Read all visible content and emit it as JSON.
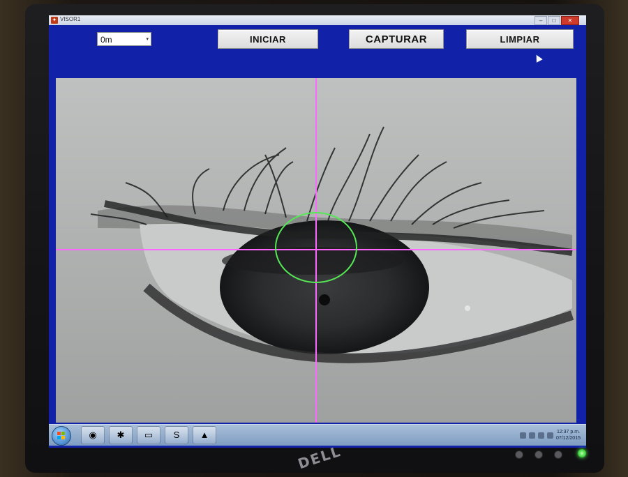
{
  "window": {
    "title": "VISOR1"
  },
  "toolbar": {
    "distance_select": {
      "value": "0m"
    },
    "iniciar_label": "INICIAR",
    "capturar_label": "CAPTURAR",
    "limpiar_label": "LIMPIAR"
  },
  "overlay": {
    "crosshair_color": "#ff66ff",
    "circle_color": "#55e855"
  },
  "taskbar": {
    "items": [
      "start-orb",
      "chrome",
      "app",
      "explorer",
      "skype",
      "matlab"
    ],
    "clock_time": "12:37 p.m.",
    "clock_date": "07/12/2015"
  },
  "monitor": {
    "brand": "DELL"
  },
  "colors": {
    "app_background": "#1122a8",
    "power_led": "#3bd13a"
  }
}
